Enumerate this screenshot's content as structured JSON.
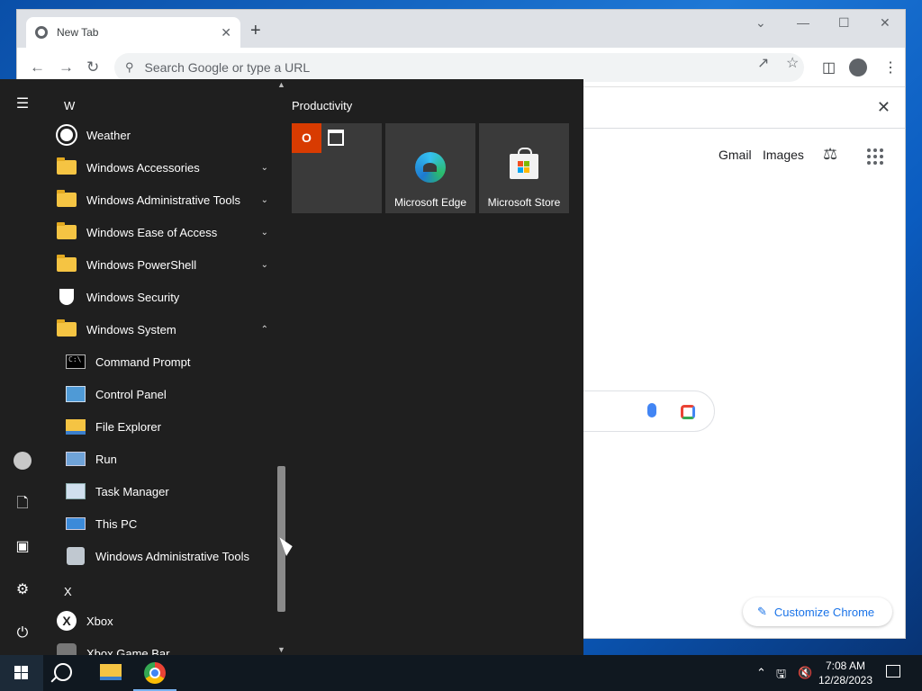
{
  "chrome": {
    "tab_title": "New Tab",
    "tab_close": "✕",
    "new_tab": "+",
    "window_controls": {
      "tab_search": "⌄",
      "minimize": "—",
      "maximize": "☐",
      "close": "✕"
    },
    "nav": {
      "back": "←",
      "forward": "→",
      "reload": "↻"
    },
    "omnibox_placeholder": "Search Google or type a URL",
    "toolbar_icons": [
      "share-icon",
      "star-icon",
      "side-panel-icon",
      "profile-icon",
      "menu-icon"
    ],
    "info_bar_close": "✕",
    "links": {
      "gmail": "Gmail",
      "images": "Images"
    },
    "customize_label": "Customize Chrome"
  },
  "start_menu": {
    "letters": {
      "w": "W",
      "x": "X"
    },
    "apps": [
      {
        "label": "Weather",
        "icon": "weather-icon"
      },
      {
        "label": "Windows Accessories",
        "icon": "folder-icon",
        "expandable": true,
        "expanded": false
      },
      {
        "label": "Windows Administrative Tools",
        "icon": "folder-icon",
        "expandable": true,
        "expanded": false
      },
      {
        "label": "Windows Ease of Access",
        "icon": "folder-icon",
        "expandable": true,
        "expanded": false
      },
      {
        "label": "Windows PowerShell",
        "icon": "folder-icon",
        "expandable": true,
        "expanded": false
      },
      {
        "label": "Windows Security",
        "icon": "shield-icon"
      },
      {
        "label": "Windows System",
        "icon": "folder-icon",
        "expandable": true,
        "expanded": true
      }
    ],
    "system_items": [
      {
        "label": "Command Prompt",
        "icon": "command-prompt-icon"
      },
      {
        "label": "Control Panel",
        "icon": "control-panel-icon"
      },
      {
        "label": "File Explorer",
        "icon": "file-explorer-icon"
      },
      {
        "label": "Run",
        "icon": "run-icon"
      },
      {
        "label": "Task Manager",
        "icon": "task-manager-icon"
      },
      {
        "label": "This PC",
        "icon": "this-pc-icon"
      },
      {
        "label": "Windows Administrative Tools",
        "icon": "admin-tools-icon"
      }
    ],
    "x_apps": [
      {
        "label": "Xbox",
        "icon": "xbox-icon"
      },
      {
        "label": "Xbox Game Bar",
        "icon": "game-bar-icon"
      }
    ],
    "chevron_down": "⌄",
    "chevron_up": "⌃",
    "tile_group": "Productivity",
    "tiles": [
      {
        "label": "",
        "icon": "office-calendar-icon"
      },
      {
        "label": "Microsoft Edge",
        "icon": "edge-icon"
      },
      {
        "label": "Microsoft Store",
        "icon": "store-icon"
      }
    ],
    "office_letter": "O"
  },
  "taskbar": {
    "time": "7:08 AM",
    "date": "12/28/2023"
  },
  "colors": {
    "start_bg": "#1f1f1f",
    "tile_bg": "#3a3a3a",
    "accent_blue": "#1a73e8",
    "office_orange": "#d83b01"
  }
}
